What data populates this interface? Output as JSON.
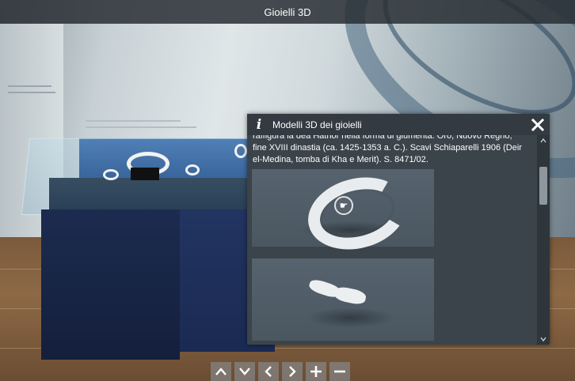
{
  "app": {
    "title": "Gioielli 3D"
  },
  "info_panel": {
    "icon": "info-icon",
    "title": "Modelli 3D dei gioielli",
    "description": "raffigura la dea Hathor nella forma di giumenta. Oro, Nuovo Regno, fine XVIII dinastia (ca. 1425-1353 a. C.). Scavi Schiaparelli 1906 (Deir el-Medina, tomba di Kha e Merit). S. 8471/02.",
    "close_icon": "close-icon",
    "models": [
      {
        "name": "ring-model",
        "cursor_icon": "hand-cursor-icon"
      },
      {
        "name": "fragment-model"
      }
    ]
  },
  "navigation": {
    "buttons": [
      {
        "name": "up-button",
        "icon": "chevron-up-icon"
      },
      {
        "name": "down-button",
        "icon": "chevron-down-icon"
      },
      {
        "name": "left-button",
        "icon": "chevron-left-icon"
      },
      {
        "name": "right-button",
        "icon": "chevron-right-icon"
      },
      {
        "name": "zoom-in-button",
        "icon": "plus-icon"
      },
      {
        "name": "zoom-out-button",
        "icon": "minus-icon"
      }
    ]
  },
  "colors": {
    "title_bar": "#282e34",
    "panel_bg": "#3b434b",
    "panel_header": "#333a41",
    "case_blue": "#1a4e9a"
  }
}
